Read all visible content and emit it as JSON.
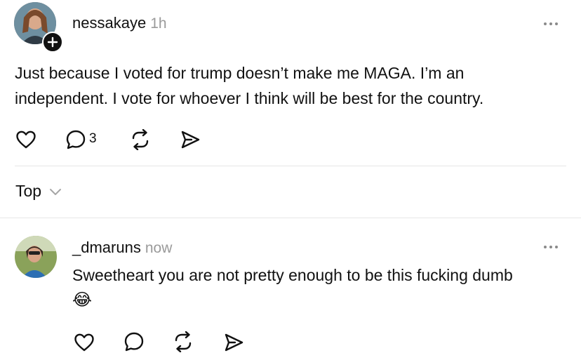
{
  "post": {
    "username": "nessakaye",
    "time": "1h",
    "text_line1": "Just because I voted for trump doesn’t make me MAGA. I’m an",
    "text_line2": "independent. I vote for whoever I think will be best for the country.",
    "reply_count": "3"
  },
  "sort": {
    "label": "Top"
  },
  "reply": {
    "username": "_dmaruns",
    "time": "now",
    "text": "Sweetheart you are not pretty enough to be this fucking dumb",
    "emoji": "😂"
  },
  "colors": {
    "muted": "#9a9a9a",
    "divider": "#e6e6e6"
  }
}
